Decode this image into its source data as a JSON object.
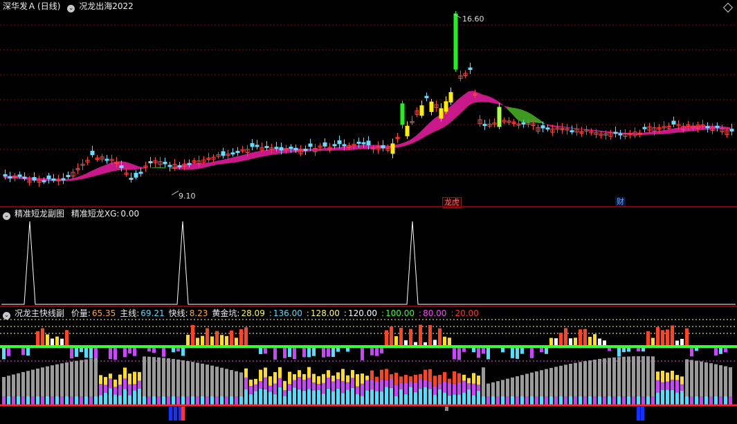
{
  "main_panel": {
    "stock_name": "深华发Ａ",
    "period": "(日线)",
    "indicator": "况龙出海2022",
    "high_label": "16.60",
    "low_label": "9.10",
    "badges": [
      {
        "text": "龙虎",
        "color": "#ff7070"
      },
      {
        "text": "财",
        "color": "#66aaff"
      }
    ]
  },
  "sub_panel_1": {
    "name": "精准短龙副图",
    "series_label": "精准短龙XG:",
    "series_value": "0.00"
  },
  "sub_panel_2": {
    "name": "况龙主快线副",
    "items": [
      {
        "label": "价量:",
        "value": "65.35",
        "color": "#ffaa33"
      },
      {
        "label": "主线:",
        "value": "69.21",
        "color": "#55ddff"
      },
      {
        "label": "快线:",
        "value": "8.23",
        "color": "#ffaa33"
      },
      {
        "label": "黄金坑:",
        "value": "28.09",
        "color": "#ffff33"
      },
      {
        "label": ":",
        "value": "136.00",
        "color": "#55ddff"
      },
      {
        "label": ":",
        "value": "128.00",
        "color": "#ffff66"
      },
      {
        "label": ":",
        "value": "120.00",
        "color": "#ffffff"
      },
      {
        "label": ":",
        "value": "100.00",
        "color": "#33ff33"
      },
      {
        "label": ":",
        "value": "80.00",
        "color": "#ff44ff"
      },
      {
        "label": ":",
        "value": "20.00",
        "color": "#ff3333"
      }
    ]
  },
  "colors": {
    "up": "#ff4444",
    "down": "#66ddff",
    "band_pink": "#c8188a",
    "band_green": "#3e9a1e",
    "grid": "#8b0000"
  }
}
